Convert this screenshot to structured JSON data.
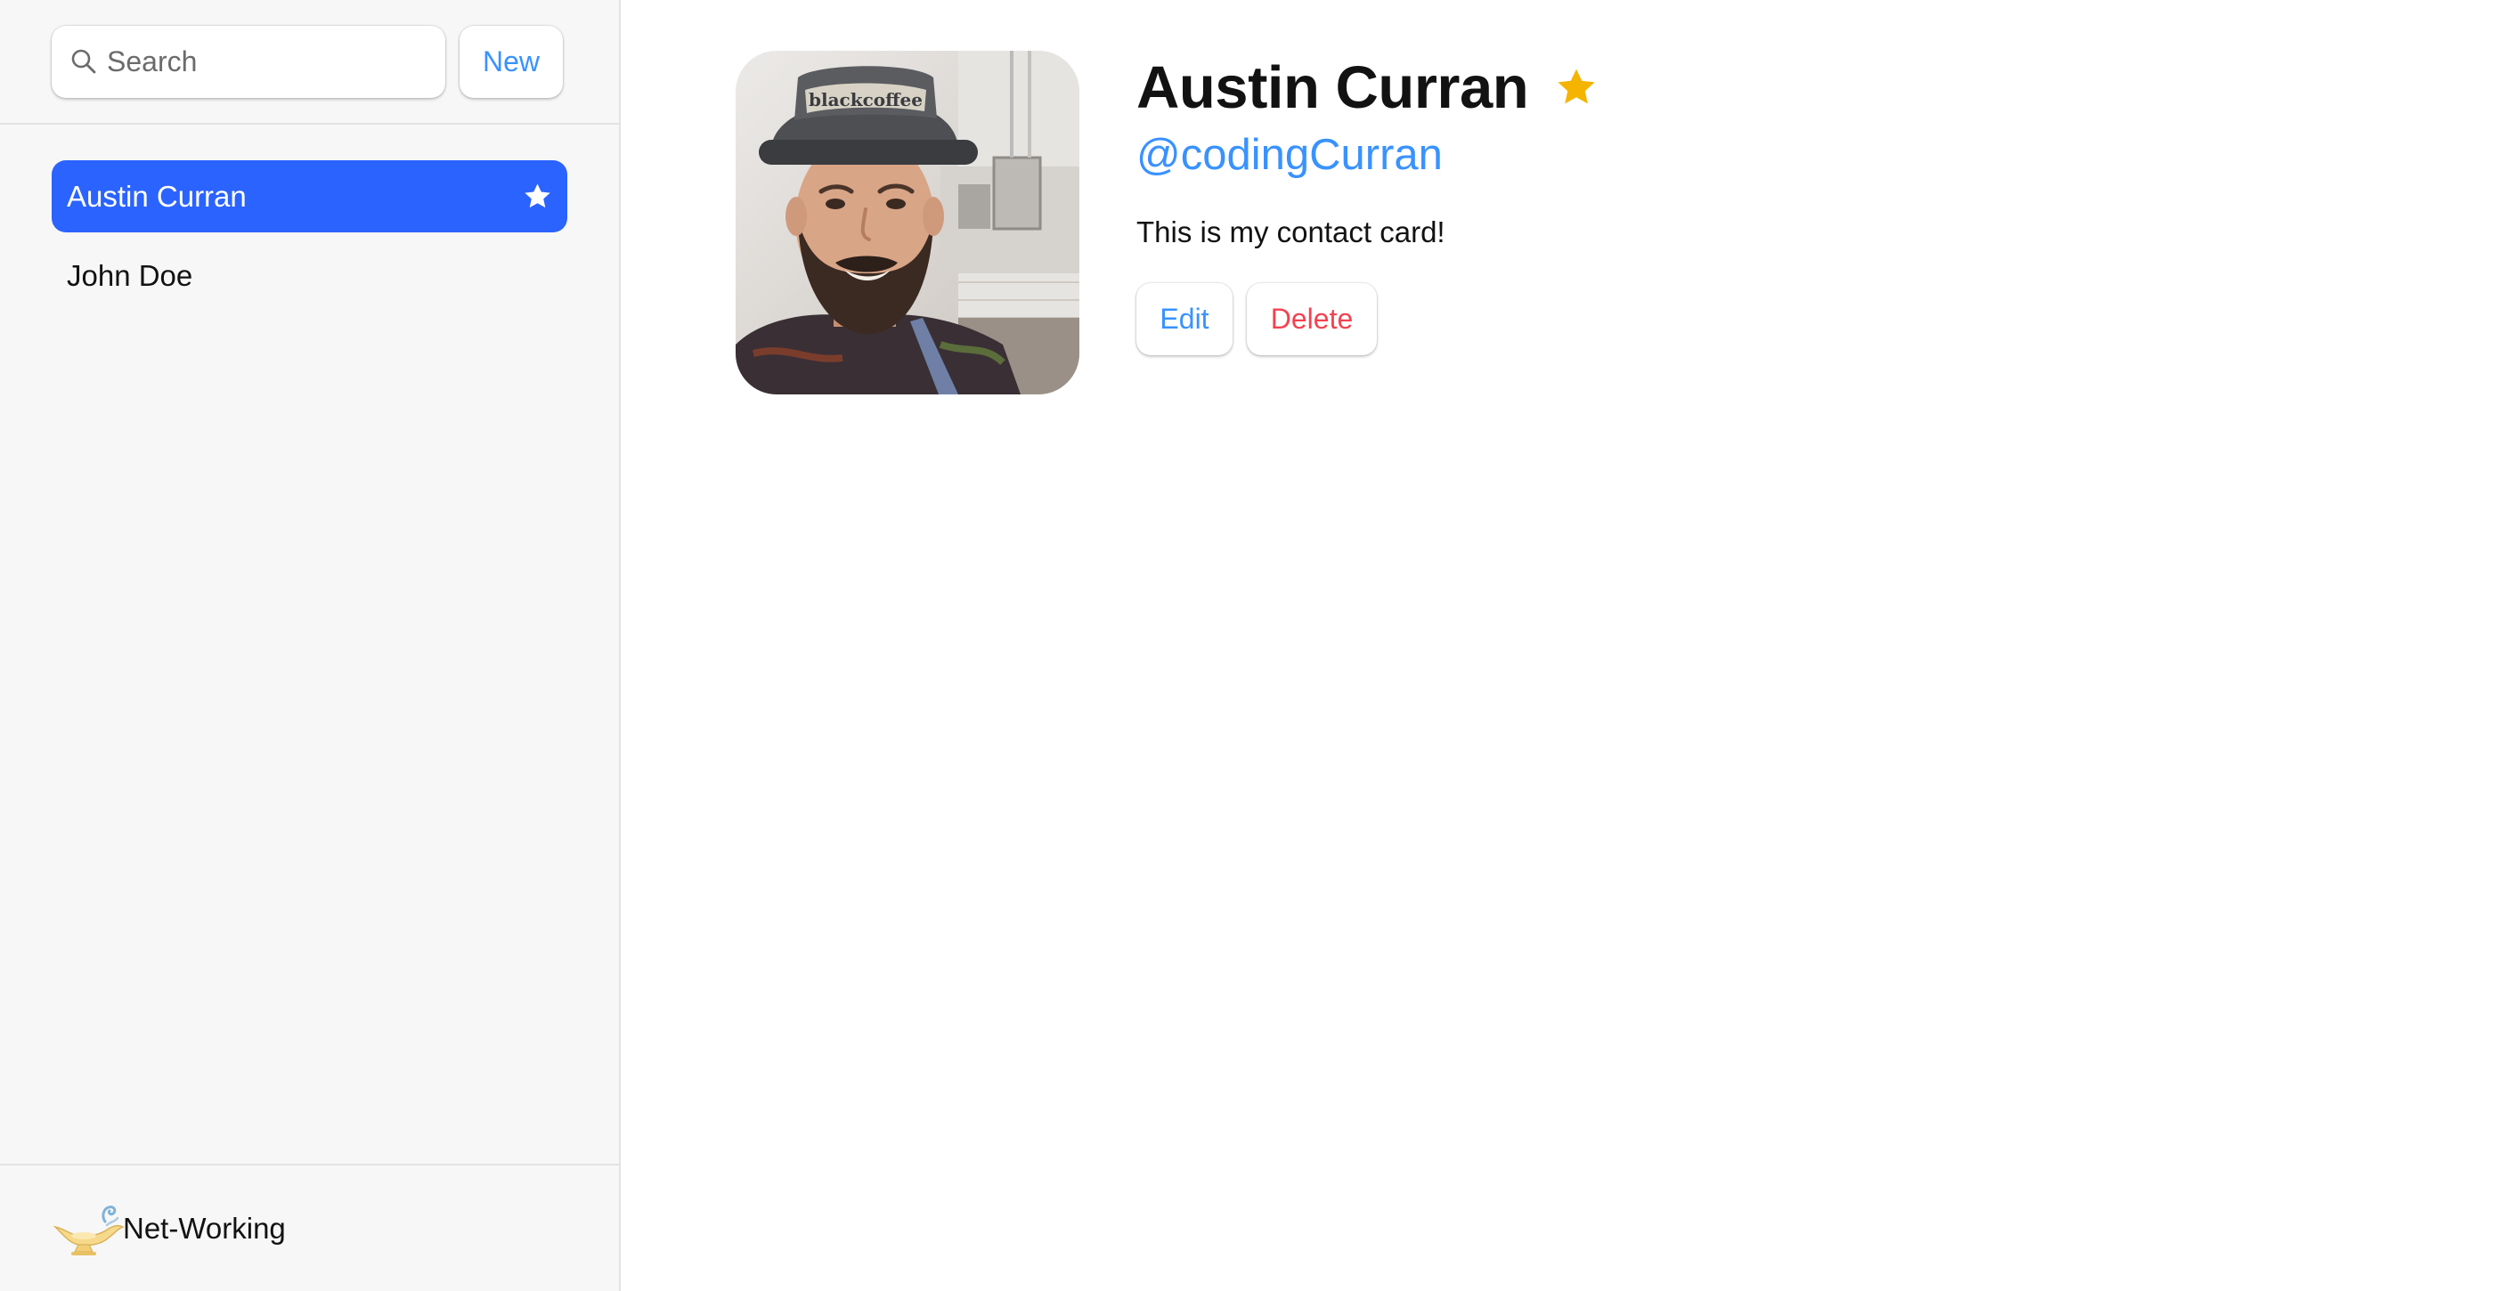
{
  "sidebar": {
    "search": {
      "placeholder": "Search",
      "value": ""
    },
    "new_button": "New",
    "contacts": [
      {
        "name": "Austin Curran",
        "favorite": true,
        "active": true
      },
      {
        "name": "John Doe",
        "favorite": false,
        "active": false
      }
    ],
    "footer": {
      "brand": "Net-Working",
      "logo_icon": "magic-lamp-icon"
    }
  },
  "contact": {
    "name": "Austin Curran",
    "favorite": true,
    "twitter": "@codingCurran",
    "notes": "This is my contact card!",
    "edit_label": "Edit",
    "delete_label": "Delete"
  },
  "colors": {
    "accent": "#3992ff",
    "active_bg": "#2b63ff",
    "danger": "#f44250",
    "star": "#f4b400",
    "sidebar_bg": "#f7f7f7"
  }
}
